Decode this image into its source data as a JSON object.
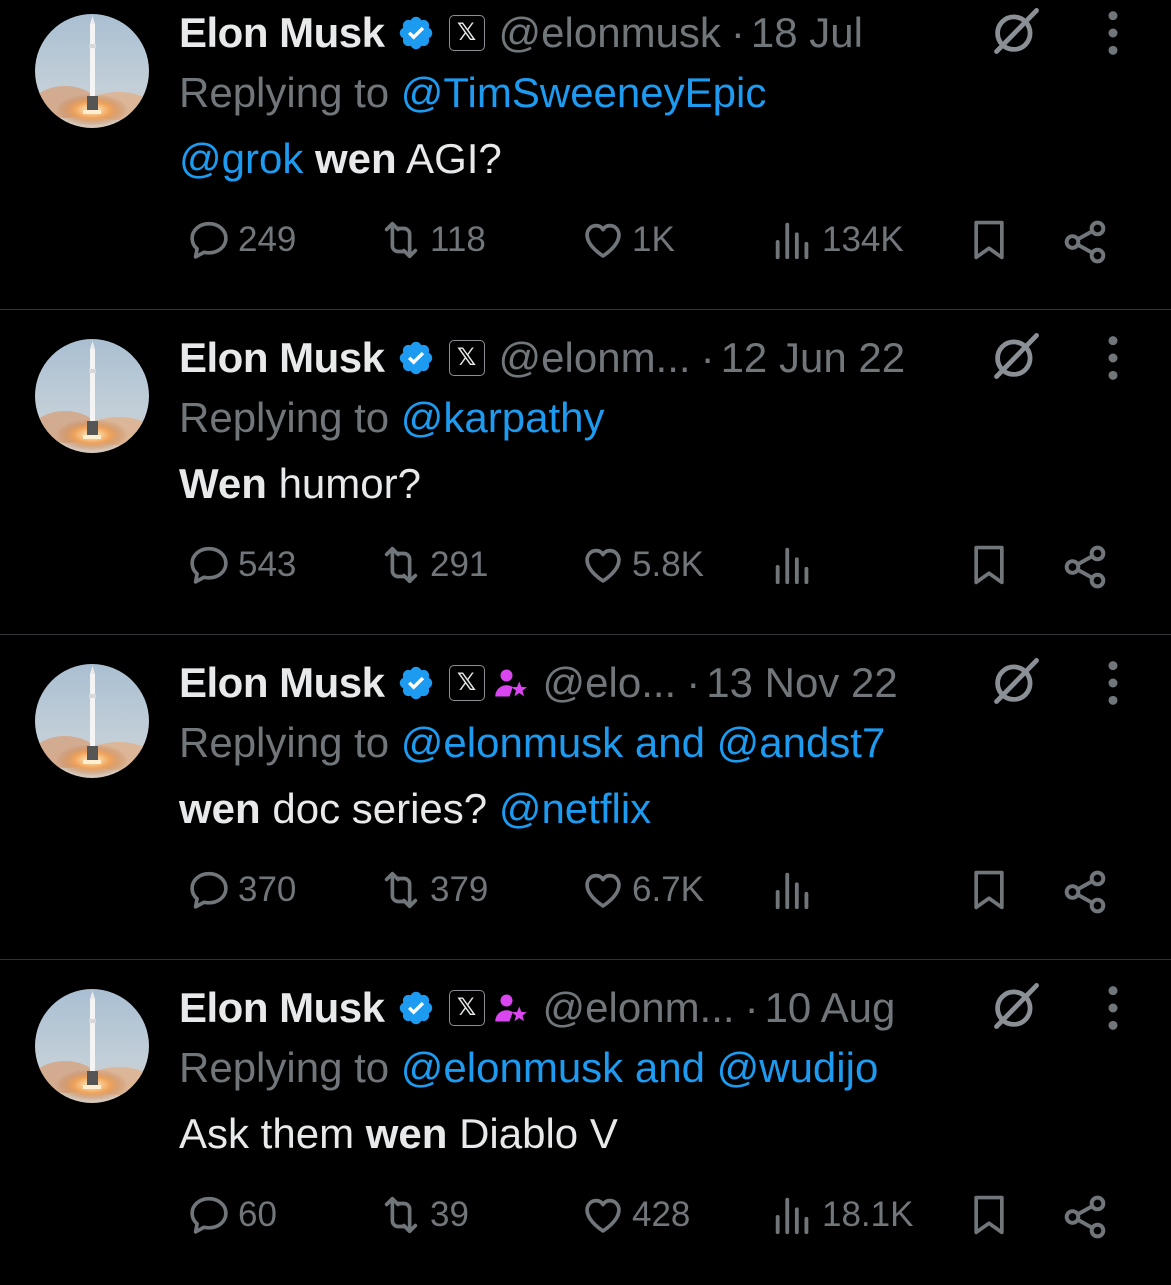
{
  "tweets": [
    {
      "name": "Elon Musk",
      "handle": "@elonmusk",
      "date": "18 Jul",
      "reply_prefix": "Replying to ",
      "reply_mentions": "@TimSweeneyEpic",
      "text_parts": [
        {
          "text": "@grok",
          "style": "link"
        },
        {
          "text": " ",
          "style": "plain"
        },
        {
          "text": "wen",
          "style": "bold"
        },
        {
          "text": " AGI?",
          "style": "plain"
        }
      ],
      "replies": "249",
      "reposts": "118",
      "likes": "1K",
      "views": "134K",
      "affiliate_badge": false
    },
    {
      "name": "Elon Musk",
      "handle": "@elonm...",
      "date": "12 Jun 22",
      "reply_prefix": "Replying to ",
      "reply_mentions": "@karpathy",
      "text_parts": [
        {
          "text": "Wen",
          "style": "bold"
        },
        {
          "text": " humor?",
          "style": "plain"
        }
      ],
      "replies": "543",
      "reposts": "291",
      "likes": "5.8K",
      "views": "",
      "affiliate_badge": false
    },
    {
      "name": "Elon Musk",
      "handle": "@elo...",
      "date": "13 Nov 22",
      "reply_prefix": "Replying to ",
      "reply_mentions": "@elonmusk and @andst7",
      "text_parts": [
        {
          "text": "wen",
          "style": "bold"
        },
        {
          "text": " doc series? ",
          "style": "plain"
        },
        {
          "text": "@netflix",
          "style": "link"
        }
      ],
      "replies": "370",
      "reposts": "379",
      "likes": "6.7K",
      "views": "",
      "affiliate_badge": true
    },
    {
      "name": "Elon Musk",
      "handle": "@elonm...",
      "date": "10 Aug",
      "reply_prefix": "Replying to ",
      "reply_mentions": "@elonmusk and @wudijo",
      "text_parts": [
        {
          "text": "Ask them ",
          "style": "plain"
        },
        {
          "text": "wen",
          "style": "bold"
        },
        {
          "text": " Diablo V",
          "style": "plain"
        }
      ],
      "replies": "60",
      "reposts": "39",
      "likes": "428",
      "views": "18.1K",
      "affiliate_badge": true
    }
  ],
  "separator": "·",
  "x_badge_glyph": "𝕏",
  "colors": {
    "background": "#000000",
    "text": "#e7e9ea",
    "muted": "#71767b",
    "link": "#1d9bf0",
    "verified": "#1d9bf0",
    "affiliate": "#d946ef"
  },
  "icons": [
    "reply-icon",
    "repost-icon",
    "like-icon",
    "views-icon",
    "bookmark-icon",
    "share-icon",
    "grok-icon",
    "more-icon",
    "verified-badge-icon",
    "x-affiliate-badge-icon",
    "affiliate-person-star-icon"
  ]
}
